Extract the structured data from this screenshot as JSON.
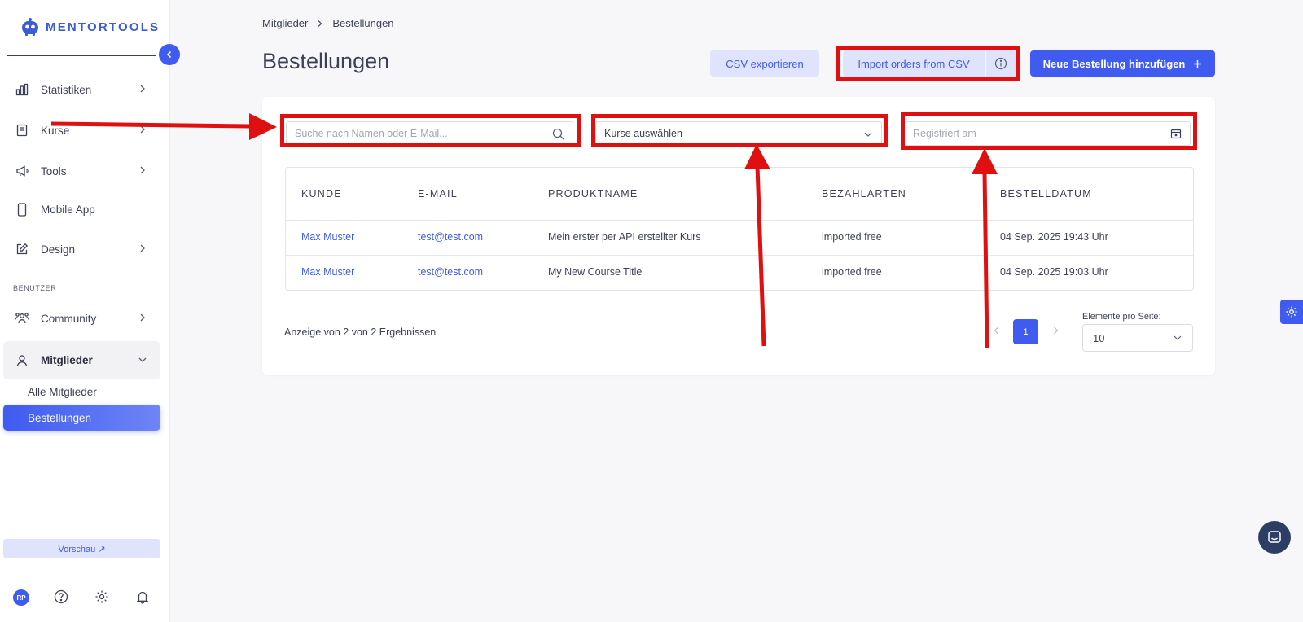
{
  "brand": {
    "name": "MENTORTOOLS"
  },
  "sidebar": {
    "items": [
      {
        "label": "Statistiken",
        "icon": "bar-chart-icon"
      },
      {
        "label": "Kurse",
        "icon": "book-icon"
      },
      {
        "label": "Tools",
        "icon": "megaphone-icon"
      },
      {
        "label": "Mobile App",
        "icon": "phone-icon"
      },
      {
        "label": "Design",
        "icon": "pencil-icon"
      }
    ],
    "section_label": "BENUTZER",
    "user_items": [
      {
        "label": "Community",
        "icon": "users-icon"
      },
      {
        "label": "Mitglieder",
        "icon": "user-icon"
      }
    ],
    "sub_items": [
      {
        "label": "Alle Mitglieder"
      },
      {
        "label": "Bestellungen"
      }
    ],
    "preview_label": "Vorschau ↗",
    "avatar_initials": "RP"
  },
  "breadcrumb": {
    "parent": "Mitglieder",
    "current": "Bestellungen"
  },
  "page_title": "Bestellungen",
  "toolbar": {
    "export_label": "CSV exportieren",
    "import_label": "Import orders from CSV",
    "new_label": "Neue Bestellung hinzufügen"
  },
  "filters": {
    "search_placeholder": "Suche nach Namen oder E-Mail...",
    "course_value": "Kurse auswählen",
    "date_placeholder": "Registriert am"
  },
  "table": {
    "headers": [
      "KUNDE",
      "E-MAIL",
      "PRODUKTNAME",
      "BEZAHLARTEN",
      "BESTELLDATUM"
    ],
    "rows": [
      {
        "customer": "Max Muster",
        "email": "test@test.com",
        "product": "Mein erster per API erstellter Kurs",
        "payment": "imported free",
        "date": "04 Sep. 2025 19:43 Uhr"
      },
      {
        "customer": "Max Muster",
        "email": "test@test.com",
        "product": "My New Course Title",
        "payment": "imported free",
        "date": "04 Sep. 2025 19:03 Uhr"
      }
    ]
  },
  "pagination": {
    "results_text": "Anzeige von 2 von 2 Ergebnissen",
    "current_page": "1",
    "per_page_label": "Elemente pro Seite:",
    "per_page_value": "10"
  },
  "colors": {
    "accent": "#3f5bf0",
    "annotation": "#e01010"
  }
}
